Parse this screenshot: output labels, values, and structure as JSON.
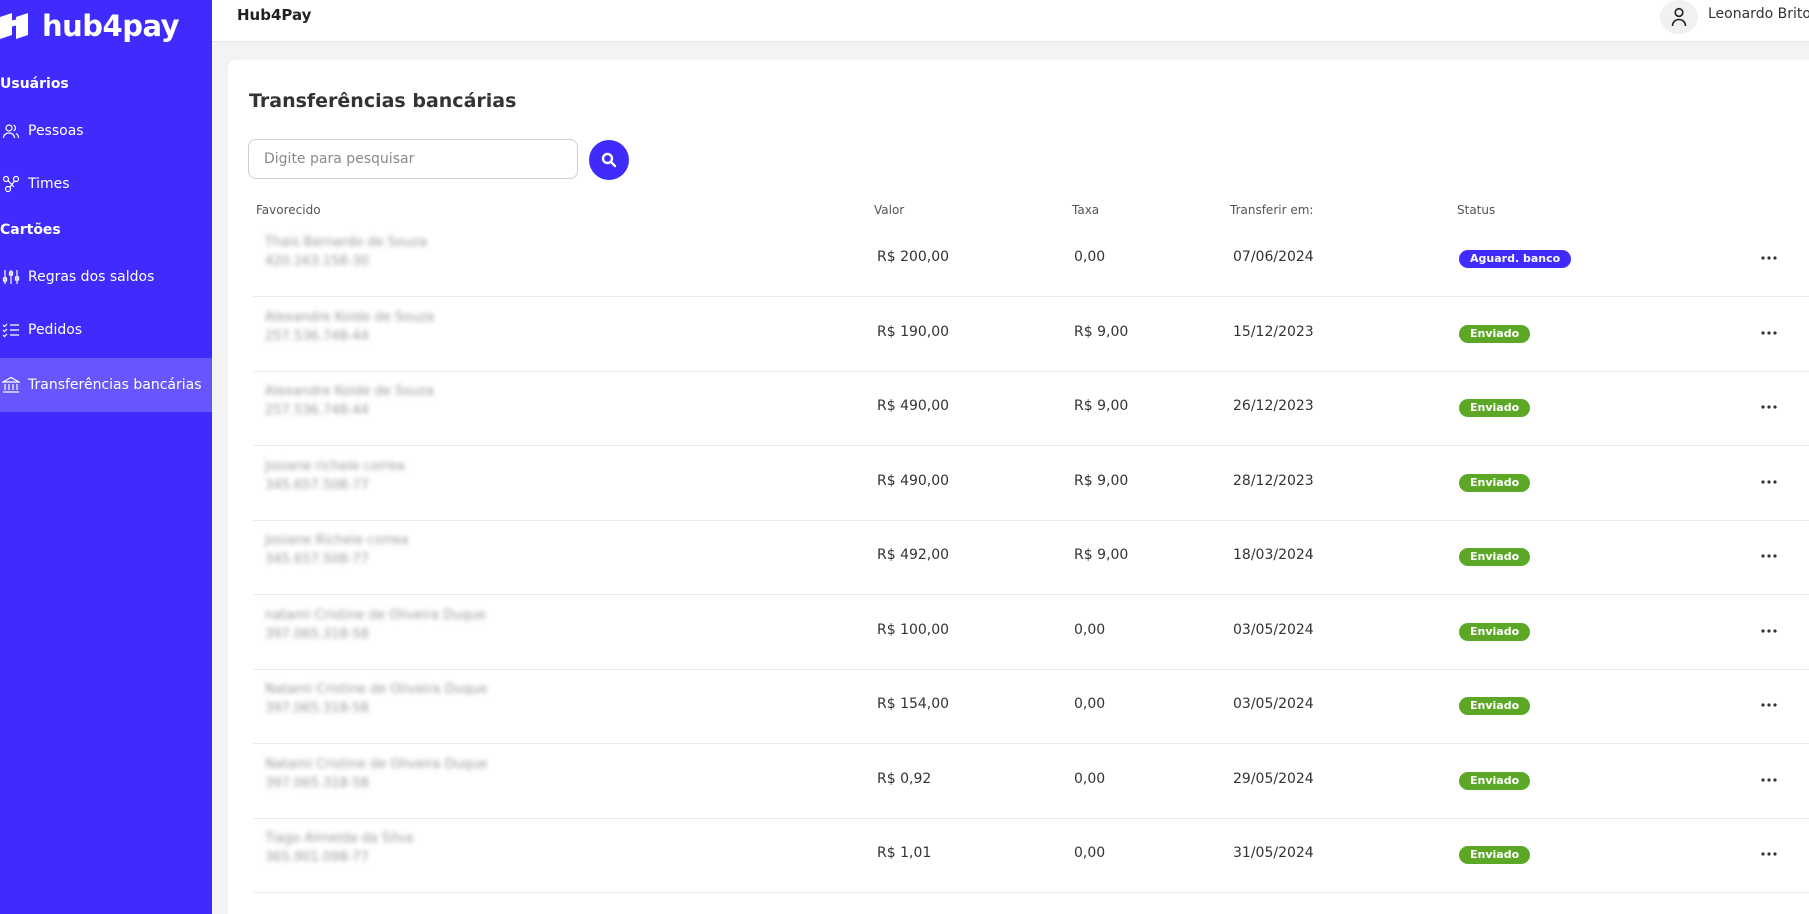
{
  "brand": {
    "name": "hub4pay"
  },
  "topbar": {
    "title": "Hub4Pay",
    "user_name": "Leonardo Brito"
  },
  "sidebar": {
    "sections": [
      {
        "title": "Usuários",
        "items": [
          {
            "label": "Pessoas",
            "icon": "users-icon"
          },
          {
            "label": "Times",
            "icon": "team-icon"
          }
        ]
      },
      {
        "title": "Cartões",
        "items": [
          {
            "label": "Regras dos saldos",
            "icon": "sliders-icon"
          },
          {
            "label": "Pedidos",
            "icon": "list-check-icon"
          },
          {
            "label": "Transferências bancárias",
            "icon": "bank-icon",
            "active": true
          }
        ]
      }
    ]
  },
  "page": {
    "title": "Transferências bancárias"
  },
  "search": {
    "placeholder": "Digite para pesquisar"
  },
  "table": {
    "headers": {
      "favorecido": "Favorecido",
      "valor": "Valor",
      "taxa": "Taxa",
      "transferir_em": "Transferir em:",
      "status": "Status"
    },
    "rows": [
      {
        "name": "Thais Bernardo de Souza",
        "doc": "420.163.158-30",
        "valor": "R$ 200,00",
        "taxa": "0,00",
        "data": "07/06/2024",
        "status": "Aguard. banco",
        "status_type": "waiting"
      },
      {
        "name": "Alexandre Koide de Souza",
        "doc": "257.536.748-44",
        "valor": "R$ 190,00",
        "taxa": "R$ 9,00",
        "data": "15/12/2023",
        "status": "Enviado",
        "status_type": "sent"
      },
      {
        "name": "Alexandre Koide de Souza",
        "doc": "257.536.748-44",
        "valor": "R$ 490,00",
        "taxa": "R$ 9,00",
        "data": "26/12/2023",
        "status": "Enviado",
        "status_type": "sent"
      },
      {
        "name": "Josiane richele correa",
        "doc": "345.657.508-77",
        "valor": "R$ 490,00",
        "taxa": "R$ 9,00",
        "data": "28/12/2023",
        "status": "Enviado",
        "status_type": "sent"
      },
      {
        "name": "Josiane Richele correa",
        "doc": "345.657.508-77",
        "valor": "R$ 492,00",
        "taxa": "R$ 9,00",
        "data": "18/03/2024",
        "status": "Enviado",
        "status_type": "sent"
      },
      {
        "name": "natami Cristine de Oliveira Duque",
        "doc": "397.065.318-58",
        "valor": "R$ 100,00",
        "taxa": "0,00",
        "data": "03/05/2024",
        "status": "Enviado",
        "status_type": "sent"
      },
      {
        "name": "Natami Cristine de Oliveira Duque",
        "doc": "397.065.318-58",
        "valor": "R$ 154,00",
        "taxa": "0,00",
        "data": "03/05/2024",
        "status": "Enviado",
        "status_type": "sent"
      },
      {
        "name": "Natami Cristine de Oliveira Duque",
        "doc": "397.065.318-58",
        "valor": "R$ 0,92",
        "taxa": "0,00",
        "data": "29/05/2024",
        "status": "Enviado",
        "status_type": "sent"
      },
      {
        "name": "Tiago Almeida da Silva",
        "doc": "365.901.098-77",
        "valor": "R$ 1,01",
        "taxa": "0,00",
        "data": "31/05/2024",
        "status": "Enviado",
        "status_type": "sent"
      }
    ]
  },
  "colors": {
    "primary": "#3f2bfb",
    "active_nav": "#6656fc",
    "success": "#5ca826"
  }
}
